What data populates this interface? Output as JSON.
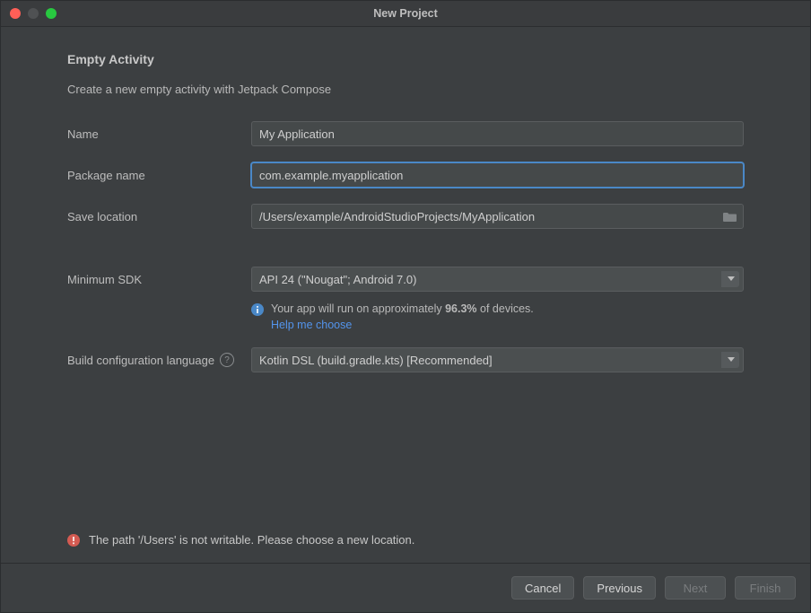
{
  "window": {
    "title": "New Project"
  },
  "header": {
    "heading": "Empty Activity",
    "subheading": "Create a new empty activity with Jetpack Compose"
  },
  "labels": {
    "name": "Name",
    "package": "Package name",
    "save": "Save location",
    "minsdk": "Minimum SDK",
    "buildlang": "Build configuration language"
  },
  "fields": {
    "name": "My Application",
    "package": "com.example.myapplication",
    "save": "/Users/example/AndroidStudioProjects/MyApplication",
    "minsdk": "API 24 (\"Nougat\"; Android 7.0)",
    "buildlang": "Kotlin DSL (build.gradle.kts) [Recommended]"
  },
  "hint": {
    "prefix": "Your app will run on approximately ",
    "pct": "96.3%",
    "suffix": " of devices.",
    "link": "Help me choose"
  },
  "error": "The path '/Users' is not writable. Please choose a new location.",
  "buttons": {
    "cancel": "Cancel",
    "previous": "Previous",
    "next": "Next",
    "finish": "Finish"
  }
}
